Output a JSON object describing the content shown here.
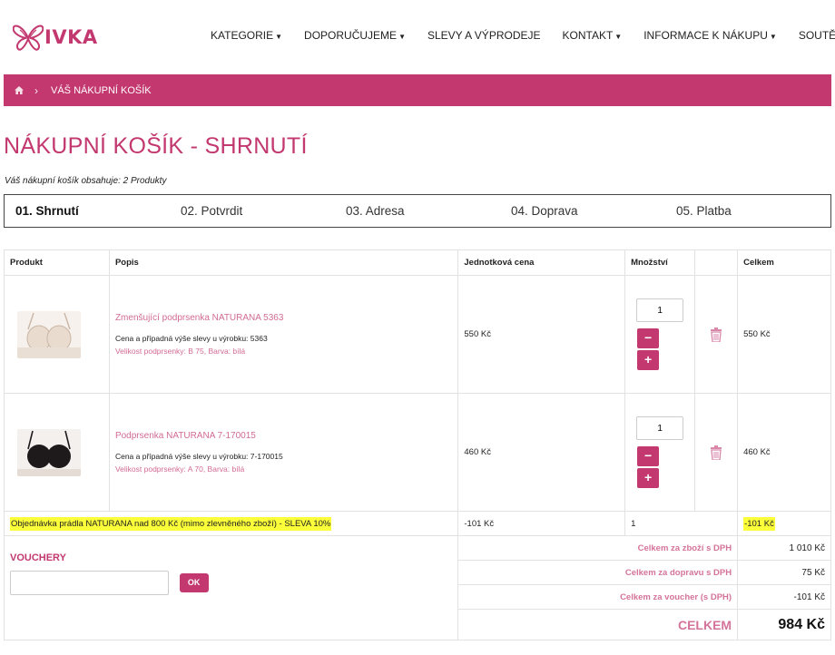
{
  "logo": {
    "text": "IVKA"
  },
  "nav": [
    {
      "label": "KATEGORIE",
      "dropdown": true
    },
    {
      "label": "DOPORUČUJEME",
      "dropdown": true
    },
    {
      "label": "SLEVY A VÝPRODEJE",
      "dropdown": false
    },
    {
      "label": "KONTAKT",
      "dropdown": true
    },
    {
      "label": "INFORMACE K NÁKUPU",
      "dropdown": true
    },
    {
      "label": "SOUTĚŽ",
      "dropdown": false
    }
  ],
  "breadcrumb": {
    "current": "VÁŠ NÁKUPNÍ KOŠÍK",
    "separator": "›"
  },
  "page_title": "NÁKUPNÍ KOŠÍK - SHRNUTÍ",
  "cart_info": "Váš nákupní košík obsahuje: 2 Produkty",
  "steps": [
    "01. Shrnutí",
    "02. Potvrdit",
    "03. Adresa",
    "04. Doprava",
    "05. Platba"
  ],
  "table": {
    "headers": [
      "Produkt",
      "Popis",
      "Jednotková cena",
      "Množství",
      "",
      "Celkem"
    ],
    "products": [
      {
        "name": "Zmenšující podprsenka NATURANA 5363",
        "desc": "Cena a případná výše slevy u výrobku: 5363",
        "variant": "Velikost podprsenky: B 75, Barva: bílá",
        "price": "550 Kč",
        "qty": "1",
        "total": "550 Kč"
      },
      {
        "name": "Podprsenka NATURANA 7-170015",
        "desc": "Cena a případná výše slevy u výrobku: 7-170015",
        "variant": "Velikost podprsenky: A 70, Barva: bílá",
        "price": "460 Kč",
        "qty": "1",
        "total": "460 Kč"
      }
    ],
    "discount": {
      "label": "Objednávka prádla NATURANA nad 800 Kč (mimo zlevněného zboží) - SLEVA 10%",
      "price": "-101 Kč",
      "qty": "1",
      "total": "-101 Kč"
    },
    "qty_minus": "−",
    "qty_plus": "+"
  },
  "vouchers": {
    "title": "VOUCHERY",
    "placeholder": "",
    "button": "OK"
  },
  "summary": [
    {
      "label": "Celkem za zboží s DPH",
      "value": "1 010 Kč"
    },
    {
      "label": "Celkem za dopravu s DPH",
      "value": "75 Kč"
    },
    {
      "label": "Celkem za voucher (s DPH)",
      "value": "-101 Kč"
    }
  ],
  "grand_total": {
    "label": "CELKEM",
    "value": "984 Kč"
  },
  "colors": {
    "accent": "#c2386f",
    "highlight": "#fbff3a"
  }
}
